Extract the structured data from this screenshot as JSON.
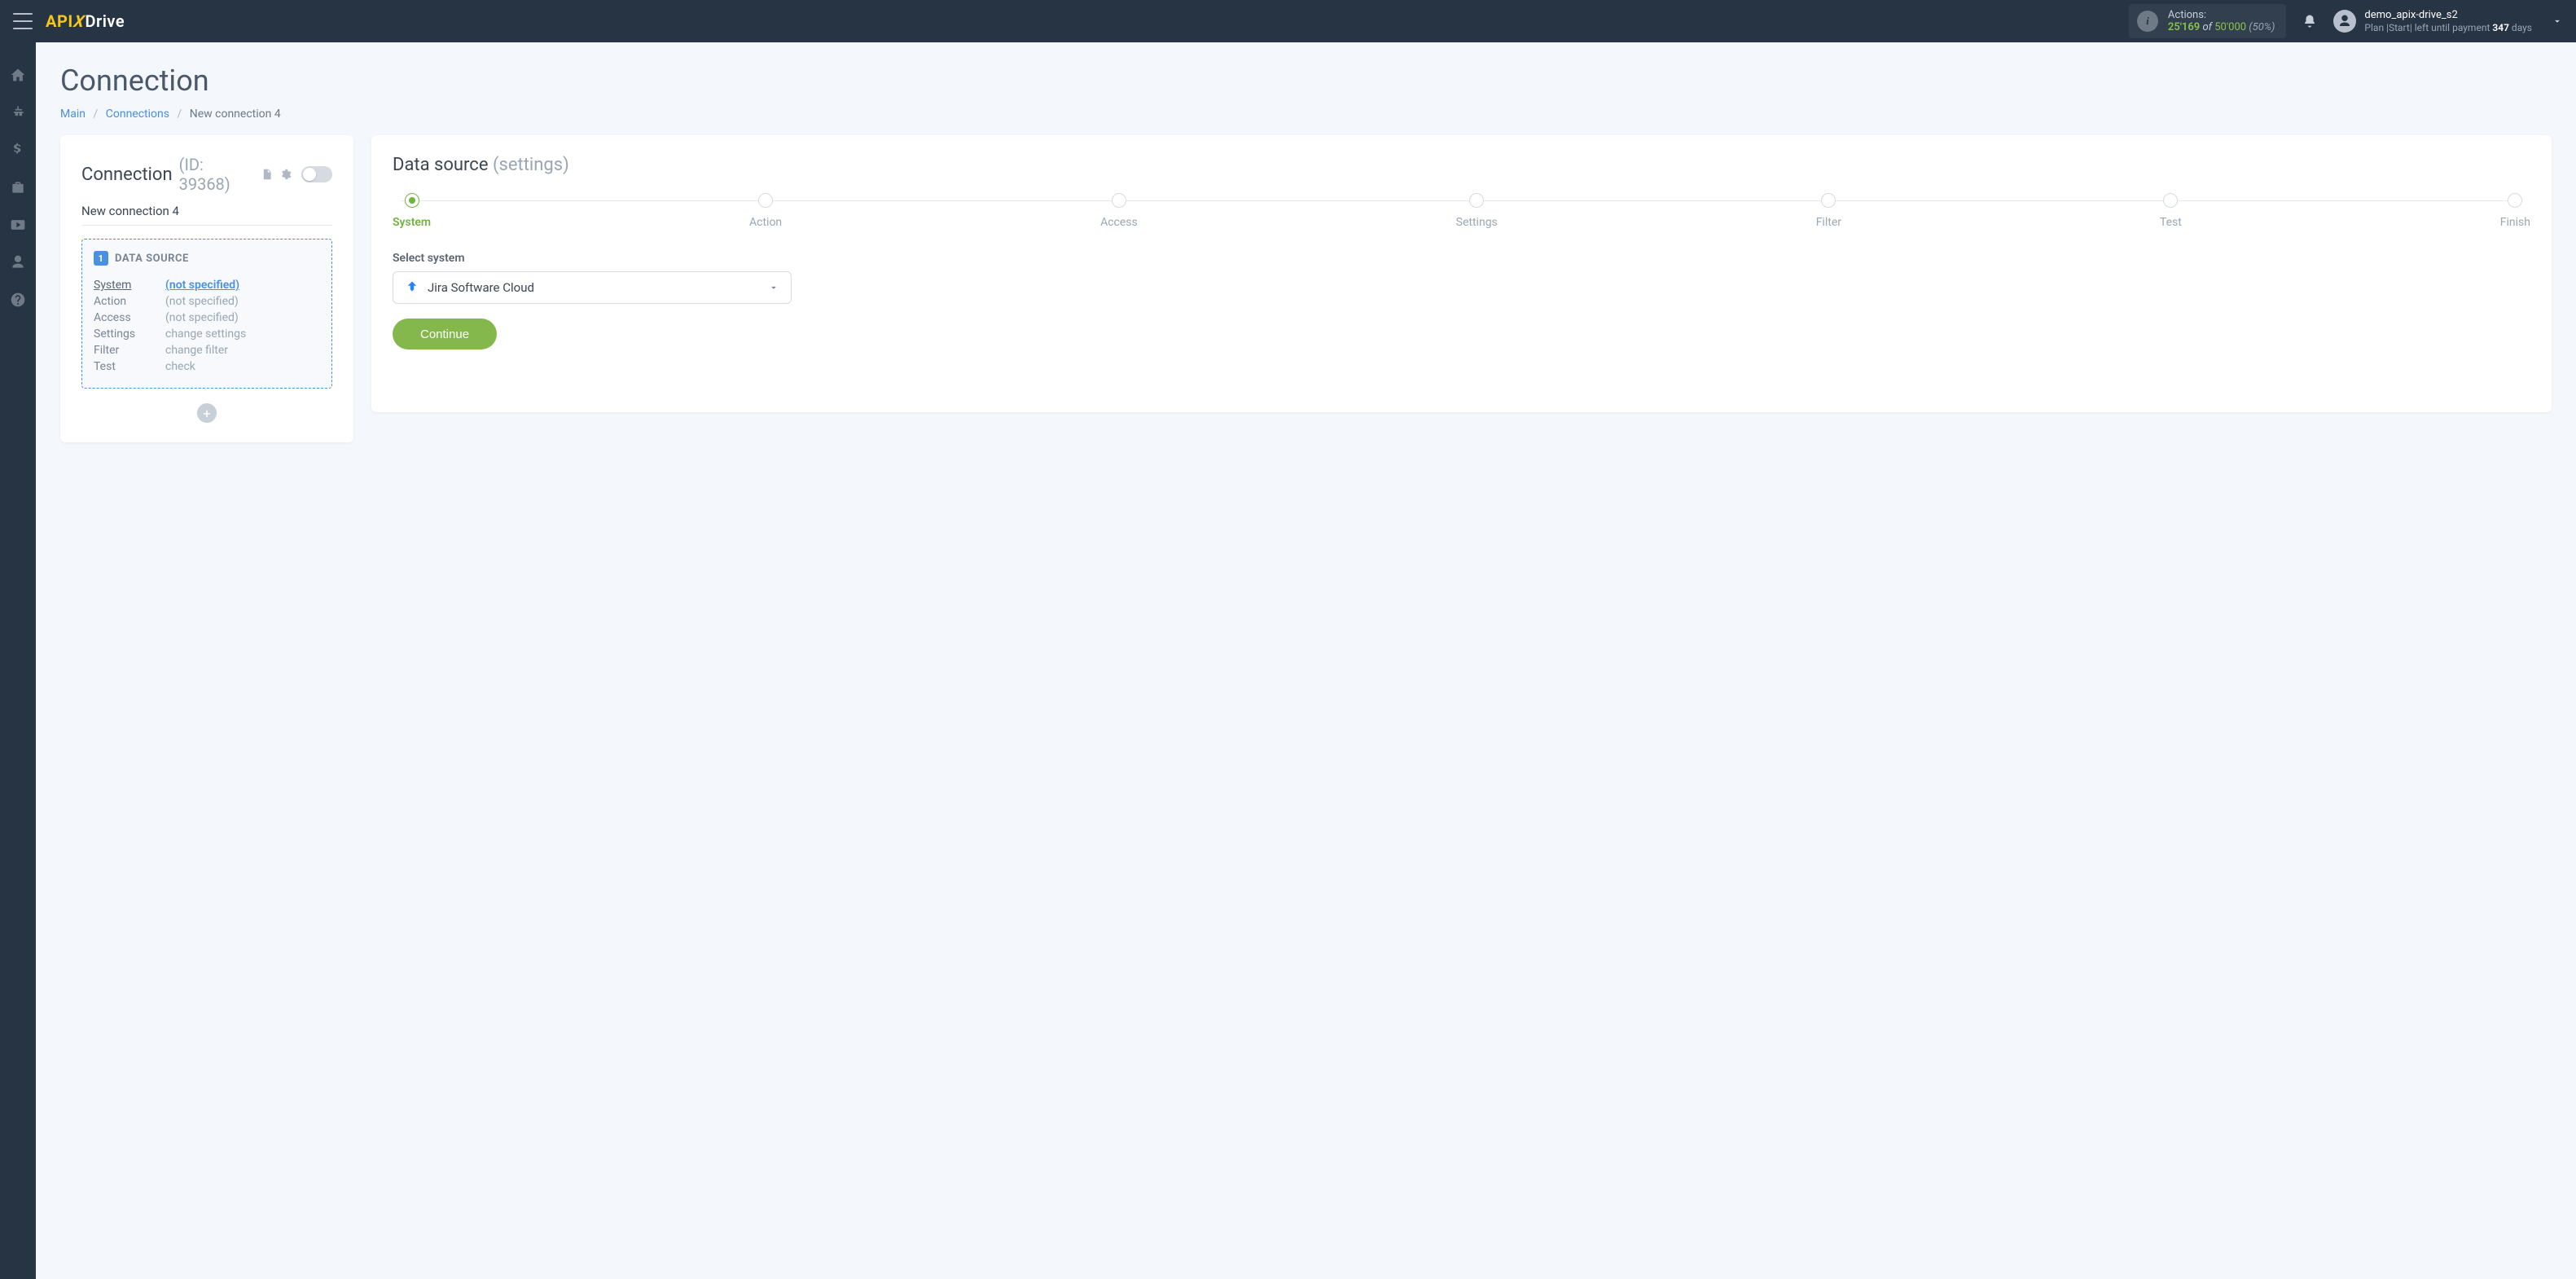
{
  "header": {
    "logo_api": "API",
    "logo_drive": "Drive",
    "actions_label": "Actions:",
    "actions_count": "25'169",
    "actions_of": "of",
    "actions_total": "50'000",
    "actions_pct": "(50%)",
    "username": "demo_apix-drive_s2",
    "plan_prefix": "Plan |Start| left until payment",
    "plan_days": "347",
    "plan_days_suffix": "days"
  },
  "page": {
    "title": "Connection",
    "breadcrumb": {
      "main": "Main",
      "connections": "Connections",
      "current": "New connection 4"
    }
  },
  "left": {
    "title": "Connection",
    "id_label": "(ID: 39368)",
    "conn_name": "New connection 4",
    "ds_badge": "1",
    "ds_title": "DATA SOURCE",
    "rows": {
      "system_k": "System",
      "system_v": "(not specified)",
      "action_k": "Action",
      "action_v": "(not specified)",
      "access_k": "Access",
      "access_v": "(not specified)",
      "settings_k": "Settings",
      "settings_v": "change settings",
      "filter_k": "Filter",
      "filter_v": "change filter",
      "test_k": "Test",
      "test_v": "check"
    }
  },
  "right": {
    "title": "Data source",
    "subtitle": "(settings)",
    "steps": [
      "System",
      "Action",
      "Access",
      "Settings",
      "Filter",
      "Test",
      "Finish"
    ],
    "field_label": "Select system",
    "selected_system": "Jira Software Cloud",
    "continue": "Continue"
  }
}
